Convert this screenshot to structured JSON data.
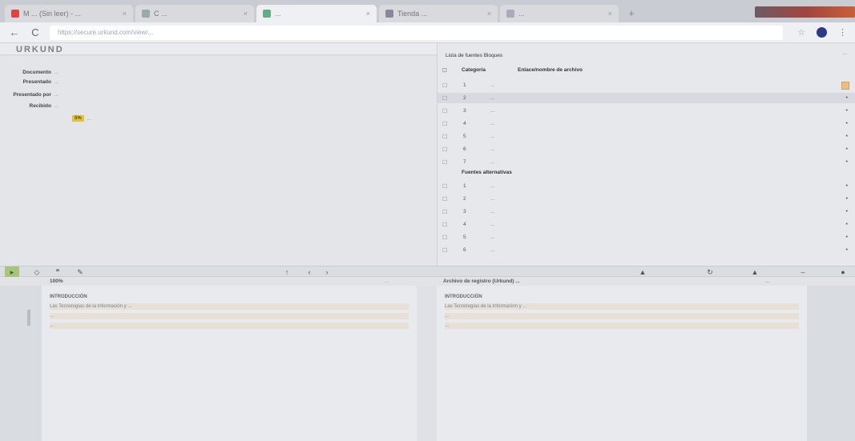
{
  "browser": {
    "tabs": [
      {
        "label": "M  ...  (Sin leer) - ...",
        "fav": "#d44",
        "active": false
      },
      {
        "label": "C  ...",
        "fav": "#9aa",
        "active": false
      },
      {
        "label": "...",
        "fav": "#6a8",
        "active": true
      },
      {
        "label": "Tienda ...",
        "fav": "#889",
        "active": false
      },
      {
        "label": "...",
        "fav": "#aab",
        "active": false
      }
    ],
    "url": "https://secure.urkund.com/view/...",
    "back": "←",
    "reload": "C"
  },
  "app": {
    "logo": "URKUND"
  },
  "info": {
    "rows": [
      {
        "label": "Documento",
        "value": "..."
      },
      {
        "label": "Presentado",
        "value": "..."
      },
      {
        "label": "Presentado por",
        "value": "..."
      },
      {
        "label": "Recibido",
        "value": "..."
      }
    ],
    "warning_badge": "5%",
    "warning_text": "..."
  },
  "sources": {
    "tab_label": "Lista de fuentes  Bloques",
    "top_right": "...",
    "header_category": "Categoría",
    "header_link": "Enlace/nombre de archivo",
    "rows": [
      {
        "rank": "1",
        "link": "..."
      },
      {
        "rank": "2",
        "link": "..."
      },
      {
        "rank": "3",
        "link": "..."
      },
      {
        "rank": "4",
        "link": "..."
      },
      {
        "rank": "5",
        "link": "..."
      },
      {
        "rank": "6",
        "link": "..."
      },
      {
        "rank": "7",
        "link": "..."
      }
    ],
    "alt_title": "Fuentes alternativas",
    "alt_rows": [
      {
        "rank": "1",
        "link": "..."
      },
      {
        "rank": "2",
        "link": "..."
      },
      {
        "rank": "3",
        "link": "..."
      },
      {
        "rank": "4",
        "link": "..."
      },
      {
        "rank": "5",
        "link": "..."
      },
      {
        "rank": "6",
        "link": "..."
      }
    ]
  },
  "toolbar": {
    "prev": "‹",
    "next": "›",
    "up": "↑",
    "warn": "▲"
  },
  "docs": {
    "left_head": "100%",
    "left_head_right": "...",
    "right_head": "Archivo de registro (Urkund) ...",
    "right_head_right": "...",
    "left_paragraphs": [
      {
        "text": "INTRODUCCIÓN",
        "kind": "title"
      },
      {
        "text": "Las Tecnologías de la Información y ...",
        "kind": "hl"
      },
      {
        "text": "...",
        "kind": "hl"
      },
      {
        "text": "...",
        "kind": "hl"
      }
    ],
    "right_paragraphs": [
      {
        "text": "INTRODUCCIÓN",
        "kind": "title"
      },
      {
        "text": "Las Tecnologías de la Información y ...",
        "kind": "hl"
      },
      {
        "text": "...",
        "kind": "hl"
      },
      {
        "text": "...",
        "kind": "hl"
      }
    ]
  }
}
